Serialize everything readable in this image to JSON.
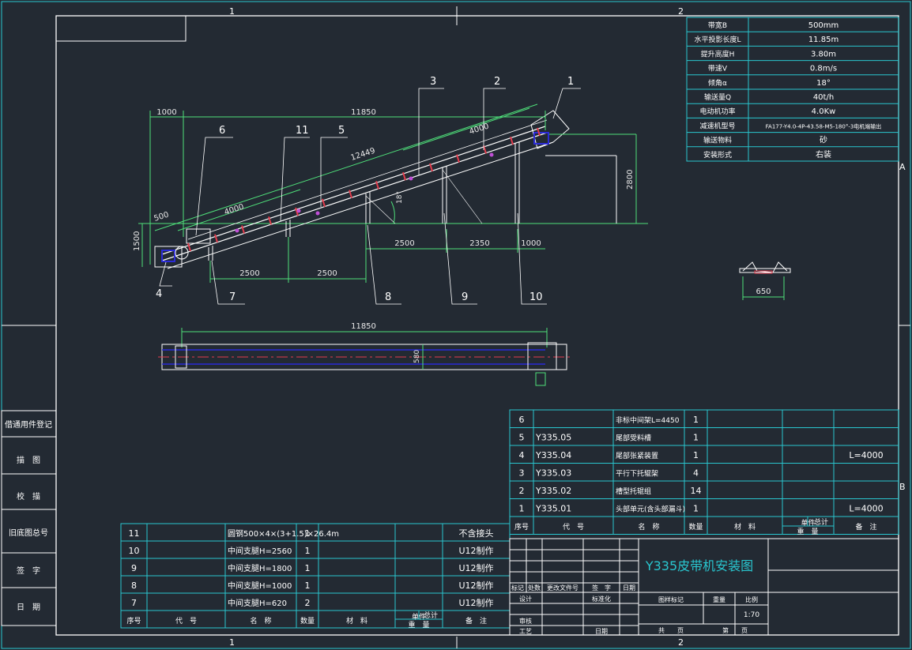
{
  "colors": {
    "background": "#232a33",
    "frame": "#ffffff",
    "table_lines": "#29c6cf",
    "dimension": "#4fe07a",
    "text": "#e8e8e8",
    "member": "#e33b4c",
    "roller": "#c04fd6",
    "belt_blue": "#2b2bd8"
  },
  "zone_labels": {
    "top_1": "1",
    "top_2": "2",
    "bottom_1": "1",
    "bottom_2": "2",
    "right_a": "A",
    "right_b": "B"
  },
  "spec_table": [
    {
      "label": "带宽B",
      "value": "500mm"
    },
    {
      "label": "水平投影长度L",
      "value": "11.85m"
    },
    {
      "label": "提升高度H",
      "value": "3.80m"
    },
    {
      "label": "带速V",
      "value": "0.8m/s"
    },
    {
      "label": "倾角α",
      "value": "18°"
    },
    {
      "label": "输送量Q",
      "value": "40t/h"
    },
    {
      "label": "电动机功率",
      "value": "4.0Kw"
    },
    {
      "label": "减速机型号",
      "value": "FA177-Y4.0-4P-43.58-M5-180°-3电机端输出"
    },
    {
      "label": "输送物料",
      "value": "砂"
    },
    {
      "label": "安装形式",
      "value": "右装"
    }
  ],
  "side_view": {
    "dimensions": {
      "d1000_top": "1000",
      "d11850_top": "11850",
      "d12449": "12449",
      "d4000_upper": "4000",
      "d4000_lower": "4000",
      "d500": "500",
      "d1500": "1500",
      "d2800": "2800",
      "angle": "18°",
      "d2500_a": "2500",
      "d2350": "2350",
      "d1000_b": "1000",
      "d2500_c": "2500",
      "d2500_d": "2500"
    },
    "balloons": {
      "b1": "1",
      "b2": "2",
      "b3": "3",
      "b4": "4",
      "b5": "5",
      "b6": "6",
      "b7": "7",
      "b8": "8",
      "b9": "9",
      "b10": "10",
      "b11": "11"
    }
  },
  "plan_view": {
    "d11850": "11850",
    "d580": "580"
  },
  "section_view": {
    "d650": "650"
  },
  "left_strip": [
    {
      "text": "借通用件登记"
    },
    {
      "text": "描　图"
    },
    {
      "text": "校　描"
    },
    {
      "text": "旧底图总号"
    },
    {
      "text": "签　字"
    },
    {
      "text": "日　期"
    }
  ],
  "parts_upper": {
    "rows": [
      {
        "no": "6",
        "code": "",
        "name": "非标中间架L=4450",
        "qty": "1",
        "material": "",
        "remark": ""
      },
      {
        "no": "5",
        "code": "Y335.05",
        "name": "尾部受料槽",
        "qty": "1",
        "material": "",
        "remark": ""
      },
      {
        "no": "4",
        "code": "Y335.04",
        "name": "尾部张紧装置",
        "qty": "1",
        "material": "",
        "remark": "L=4000"
      },
      {
        "no": "3",
        "code": "Y335.03",
        "name": "平行下托辊架",
        "qty": "4",
        "material": "",
        "remark": ""
      },
      {
        "no": "2",
        "code": "Y335.02",
        "name": "槽型托辊组",
        "qty": "14",
        "material": "",
        "remark": ""
      },
      {
        "no": "1",
        "code": "Y335.01",
        "name": "头部单元(含头部漏斗)",
        "qty": "1",
        "material": "",
        "remark": "L=4000"
      }
    ],
    "header": {
      "no": "序号",
      "code": "代　号",
      "name": "名　称",
      "qty": "数量",
      "material": "材　料",
      "unit": "单件",
      "total": "总计",
      "weight": "重　量",
      "remark": "备　注"
    }
  },
  "parts_lower": {
    "rows": [
      {
        "no": "11",
        "code": "",
        "name": "圆钢500×4×(3+1.5)×26.4m",
        "qty": "1",
        "remark": "不含接头"
      },
      {
        "no": "10",
        "code": "",
        "name": "中间支腿H=2560",
        "qty": "1",
        "remark": "U12制作"
      },
      {
        "no": "9",
        "code": "",
        "name": "中间支腿H=1800",
        "qty": "1",
        "remark": "U12制作"
      },
      {
        "no": "8",
        "code": "",
        "name": "中间支腿H=1000",
        "qty": "1",
        "remark": "U12制作"
      },
      {
        "no": "7",
        "code": "",
        "name": "中间支腿H=620",
        "qty": "2",
        "remark": "U12制作"
      }
    ],
    "header": {
      "no": "序号",
      "code": "代　号",
      "name": "名　称",
      "qty": "数量",
      "material": "材　料",
      "unit": "单件",
      "total": "总计",
      "weight": "重　量",
      "remark": "备　注"
    }
  },
  "title_block": {
    "title": "Y335皮带机安装图",
    "labels": {
      "mark": "标记",
      "count": "处数",
      "file": "更改文件号",
      "sign": "签　字",
      "date": "日期",
      "design": "设计",
      "standard": "标准化",
      "review": "审核",
      "process": "工艺",
      "approve": "日期",
      "stage": "图样标记",
      "weight": "重量",
      "scale": "比例",
      "scale_value": "1:70",
      "total_sheets": "共　　页",
      "sheet_no": "第　　页"
    }
  }
}
